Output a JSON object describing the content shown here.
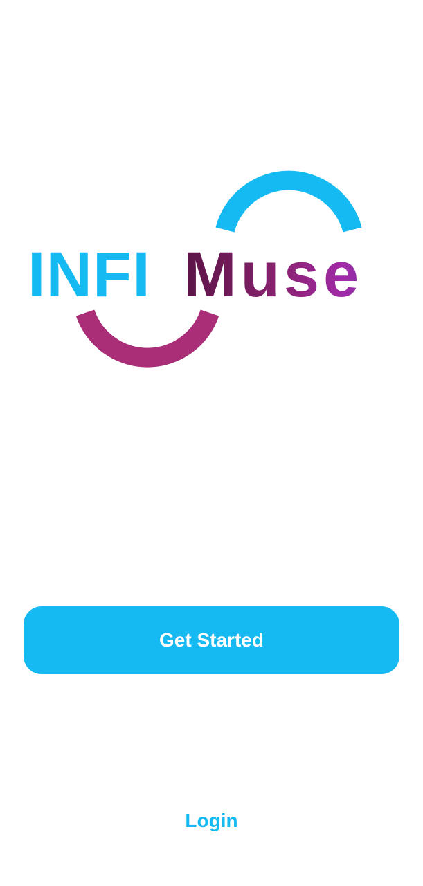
{
  "logo": {
    "part1": "INFI",
    "part2": "Muse",
    "icon": "infinity-wave-logo",
    "colors": {
      "blue": "#16baf2",
      "magenta": "#a92d77",
      "muse_start": "#5a1445",
      "muse_mid": "#a12aa8",
      "muse_end": "#5a3f9a"
    }
  },
  "actions": {
    "get_started_label": "Get Started",
    "login_label": "Login"
  },
  "theme": {
    "accent": "#16baf2",
    "background": "#ffffff",
    "button_text": "#ffffff"
  }
}
